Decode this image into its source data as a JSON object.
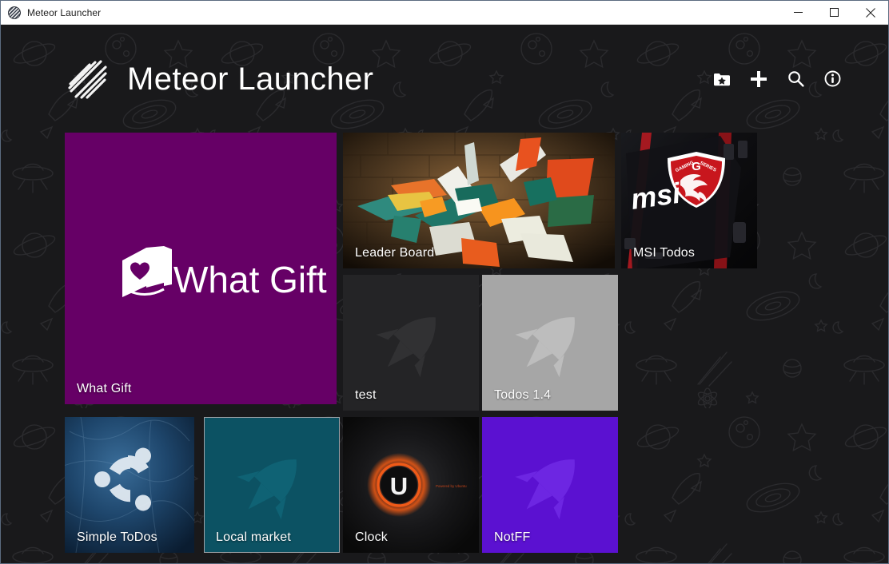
{
  "window": {
    "title": "Meteor Launcher",
    "app_icon": "meteor-sphere-icon",
    "controls": {
      "minimize": "minimize-icon",
      "maximize": "maximize-icon",
      "close": "close-icon"
    }
  },
  "header": {
    "brand_title": "Meteor Launcher",
    "logo": "meteor-streak-logo",
    "actions": [
      {
        "name": "add-folder-button",
        "icon": "folder-star-icon",
        "label": "Add folder"
      },
      {
        "name": "add-app-button",
        "icon": "plus-icon",
        "label": "Add app"
      },
      {
        "name": "search-button",
        "icon": "search-icon",
        "label": "Search"
      },
      {
        "name": "info-button",
        "icon": "info-circle-icon",
        "label": "About"
      }
    ]
  },
  "tiles": [
    {
      "id": "what-gift",
      "label": "What Gift",
      "art": "what-gift-logo",
      "bg_color": "#660066",
      "size": "large",
      "outlined": false
    },
    {
      "id": "leader-board",
      "label": "Leader Board",
      "art": "graffiti-artwork",
      "bg_color": "#3b2a18",
      "size": "wide",
      "outlined": false
    },
    {
      "id": "msi-todos",
      "label": "MSI Todos",
      "art": "msi-motherboard",
      "bg_color": "#0f0f12",
      "size": "medium",
      "outlined": false
    },
    {
      "id": "test",
      "label": "test",
      "art": "rocket-icon",
      "bg_color": "#242426",
      "rocket_color": "#313133",
      "size": "medium",
      "outlined": false
    },
    {
      "id": "todos-14",
      "label": "Todos 1.4",
      "art": "rocket-icon",
      "bg_color": "#a6a6a6",
      "rocket_color": "#bcbcbc",
      "size": "medium",
      "outlined": false
    },
    {
      "id": "simple-todos",
      "label": "Simple ToDos",
      "art": "ubuntu-logo",
      "bg_color": "#1d4060",
      "size": "medium",
      "outlined": false
    },
    {
      "id": "local-market",
      "label": "Local market",
      "art": "rocket-icon",
      "bg_color": "#0c5263",
      "rocket_color": "#0f6072",
      "size": "medium",
      "outlined": true
    },
    {
      "id": "clock",
      "label": "Clock",
      "art": "ubuntu-u-glow",
      "bg_color": "#151517",
      "caption": "Powered by Ubuntu",
      "size": "medium",
      "outlined": false
    },
    {
      "id": "notff",
      "label": "NotFF",
      "art": "rocket-icon",
      "bg_color": "#5b11d1",
      "rocket_color": "#6a22e0",
      "size": "medium",
      "outlined": false
    }
  ],
  "colors": {
    "background": "#19191b",
    "titlebar": "#ffffff",
    "window_border": "#5b6b80",
    "accent_purple": "#660066",
    "accent_violet": "#5b11d1",
    "accent_teal": "#0c5263"
  }
}
